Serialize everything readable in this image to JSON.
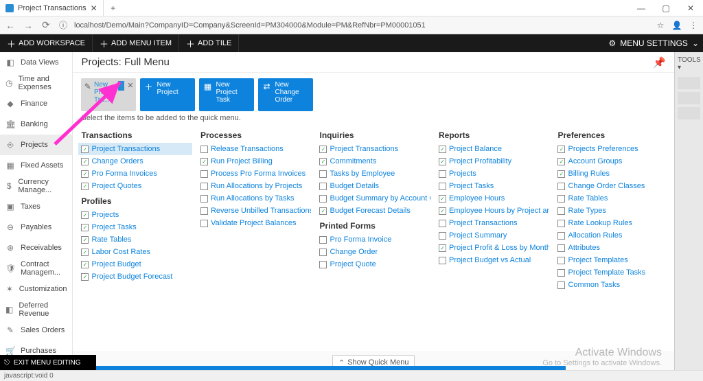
{
  "browser": {
    "tab_title": "Project Transactions",
    "new_tab": "+",
    "url": "localhost/Demo/Main?CompanyID=Company&ScreenId=PM304000&Module=PM&RefNbr=PM00001051",
    "back": "←",
    "forward": "→",
    "reload": "⟳",
    "info": "ⓘ",
    "star": "☆",
    "user": "👤",
    "menu": "⋮",
    "min": "—",
    "max": "▢",
    "close": "✕"
  },
  "menubar": {
    "add_workspace": "ADD WORKSPACE",
    "add_menu_item": "ADD MENU ITEM",
    "add_tile": "ADD TILE",
    "menu_settings": "MENU SETTINGS",
    "chevron": "⌄"
  },
  "sidebar": [
    {
      "icon": "◧",
      "label": "Data Views"
    },
    {
      "icon": "◷",
      "label": "Time and Expenses"
    },
    {
      "icon": "◆",
      "label": "Finance"
    },
    {
      "icon": "🏛",
      "label": "Banking"
    },
    {
      "icon": "⎆",
      "label": "Projects",
      "active": true
    },
    {
      "icon": "▦",
      "label": "Fixed Assets"
    },
    {
      "icon": "$",
      "label": "Currency Manage..."
    },
    {
      "icon": "▣",
      "label": "Taxes"
    },
    {
      "icon": "⊖",
      "label": "Payables"
    },
    {
      "icon": "⊕",
      "label": "Receivables"
    },
    {
      "icon": "🛡",
      "label": "Contract Managem..."
    },
    {
      "icon": "✶",
      "label": "Customization"
    },
    {
      "icon": "◧",
      "label": "Deferred Revenue"
    },
    {
      "icon": "✎",
      "label": "Sales Orders"
    },
    {
      "icon": "🛒",
      "label": "Purchases"
    }
  ],
  "exit_label": "EXIT MENU EDITING",
  "page_title": "Projects: Full Menu",
  "tiles": [
    {
      "kind": "gray",
      "icon": "✎",
      "label": "New Project Tra..."
    },
    {
      "kind": "blue",
      "icon": "＋",
      "label": "New Project"
    },
    {
      "kind": "blue",
      "icon": "▦",
      "label": "New Project Task"
    },
    {
      "kind": "blue",
      "icon": "⇄",
      "label": "New Change Order"
    }
  ],
  "hint_text": "Select the items to be added to the quick menu.",
  "sections": {
    "Transactions": [
      {
        "l": "Project Transactions",
        "c": true,
        "sel": true
      },
      {
        "l": "Change Orders",
        "c": true
      },
      {
        "l": "Pro Forma Invoices",
        "c": true
      },
      {
        "l": "Project Quotes",
        "c": true
      }
    ],
    "Profiles": [
      {
        "l": "Projects",
        "c": true
      },
      {
        "l": "Project Tasks",
        "c": true
      },
      {
        "l": "Rate Tables",
        "c": true
      },
      {
        "l": "Labor Cost Rates",
        "c": true
      },
      {
        "l": "Project Budget",
        "c": true
      },
      {
        "l": "Project Budget Forecast",
        "c": true
      }
    ],
    "Processes": [
      {
        "l": "Release Transactions",
        "c": false
      },
      {
        "l": "Run Project Billing",
        "c": true
      },
      {
        "l": "Process Pro Forma Invoices",
        "c": false
      },
      {
        "l": "Run Allocations by Projects",
        "c": false
      },
      {
        "l": "Run Allocations by Tasks",
        "c": false
      },
      {
        "l": "Reverse Unbilled Transactions",
        "c": false
      },
      {
        "l": "Validate Project Balances",
        "c": false
      }
    ],
    "Inquiries": [
      {
        "l": "Project Transactions",
        "c": true
      },
      {
        "l": "Commitments",
        "c": true
      },
      {
        "l": "Tasks by Employee",
        "c": false
      },
      {
        "l": "Budget Details",
        "c": false
      },
      {
        "l": "Budget Summary by Account Gr...",
        "c": false
      },
      {
        "l": "Budget Forecast Details",
        "c": true
      }
    ],
    "Printed Forms": [
      {
        "l": "Pro Forma Invoice",
        "c": false
      },
      {
        "l": "Change Order",
        "c": false
      },
      {
        "l": "Project Quote",
        "c": false
      }
    ],
    "Reports": [
      {
        "l": "Project Balance",
        "c": true
      },
      {
        "l": "Project Profitability",
        "c": true
      },
      {
        "l": "Projects",
        "c": false
      },
      {
        "l": "Project Tasks",
        "c": false
      },
      {
        "l": "Employee Hours",
        "c": true
      },
      {
        "l": "Employee Hours by Project and ...",
        "c": true
      },
      {
        "l": "Project Transactions",
        "c": false
      },
      {
        "l": "Project Summary",
        "c": false
      },
      {
        "l": "Project Profit & Loss by Month",
        "c": true
      },
      {
        "l": "Project Budget vs Actual",
        "c": false
      }
    ],
    "Preferences": [
      {
        "l": "Projects Preferences",
        "c": true
      },
      {
        "l": "Account Groups",
        "c": true
      },
      {
        "l": "Billing Rules",
        "c": true
      },
      {
        "l": "Change Order Classes",
        "c": false
      },
      {
        "l": "Rate Tables",
        "c": false
      },
      {
        "l": "Rate Types",
        "c": false
      },
      {
        "l": "Rate Lookup Rules",
        "c": false
      },
      {
        "l": "Allocation Rules",
        "c": false
      },
      {
        "l": "Attributes",
        "c": false
      },
      {
        "l": "Project Templates",
        "c": false
      },
      {
        "l": "Project Template Tasks",
        "c": false
      },
      {
        "l": "Common Tasks",
        "c": false
      }
    ]
  },
  "column_layout": [
    [
      "Transactions",
      "Profiles"
    ],
    [
      "Processes"
    ],
    [
      "Inquiries",
      "Printed Forms"
    ],
    [
      "Reports"
    ],
    [
      "Preferences"
    ]
  ],
  "show_quick": "Show Quick Menu",
  "tools_label": "TOOLS ▾",
  "activate": {
    "t1": "Activate Windows",
    "t2": "Go to Settings to activate Windows."
  },
  "status_text": "javascript:void 0"
}
